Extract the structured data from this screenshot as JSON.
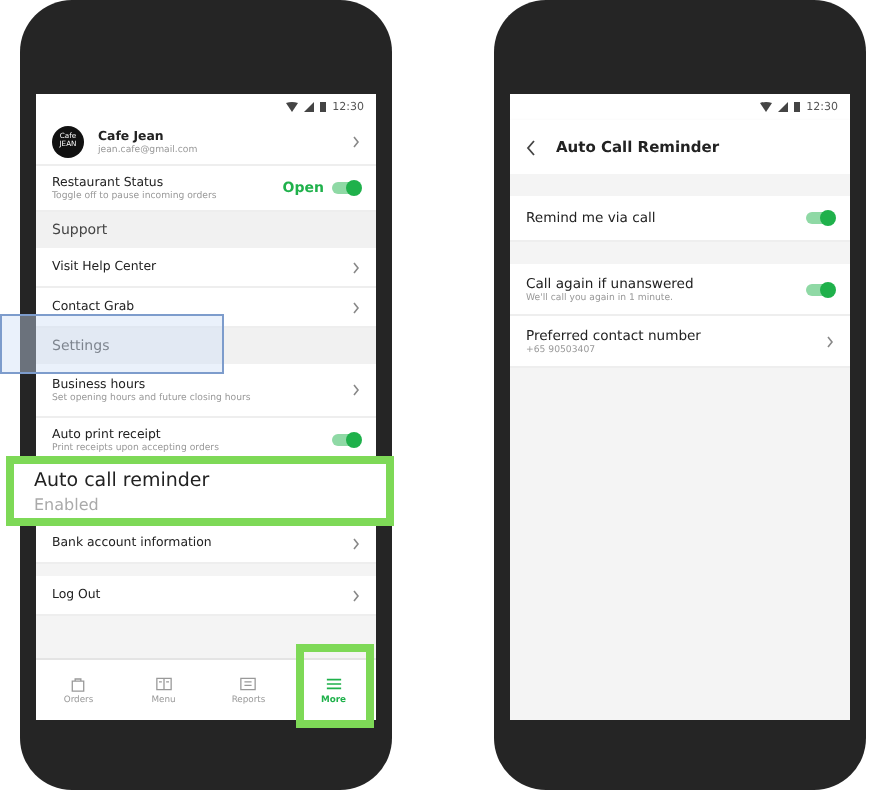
{
  "left_screen": {
    "status_bar": {
      "time": "12:30"
    },
    "profile": {
      "logo_lines": [
        "Cafe",
        "JEAN"
      ],
      "name": "Cafe Jean",
      "email": "jean.cafe@gmail.com"
    },
    "items": [
      {
        "kind": "toggle",
        "title": "Restaurant Status",
        "subtitle": "Toggle off to pause incoming orders",
        "status": "Open",
        "on": true
      },
      {
        "kind": "header",
        "title": "Support"
      },
      {
        "kind": "link",
        "title": "Visit Help Center"
      },
      {
        "kind": "link",
        "title": "Contact Grab"
      },
      {
        "kind": "header",
        "title": "Settings"
      },
      {
        "kind": "link",
        "title": "Business hours",
        "subtitle": "Set opening hours and future closing hours"
      },
      {
        "kind": "toggle",
        "title": "Auto print receipt",
        "subtitle": "Print receipts upon accepting orders",
        "on": true
      },
      {
        "kind": "covered"
      },
      {
        "kind": "link",
        "title": "Bank account information"
      },
      {
        "kind": "gap"
      },
      {
        "kind": "link",
        "title": "Log Out"
      }
    ],
    "tabs": [
      {
        "label": "Orders",
        "selected": false
      },
      {
        "label": "Menu",
        "selected": false
      },
      {
        "label": "Reports",
        "selected": false
      },
      {
        "label": "More",
        "selected": true
      }
    ],
    "callout": {
      "title": "Auto call reminder",
      "subtitle": "Enabled"
    }
  },
  "right_screen": {
    "status_bar": {
      "time": "12:30"
    },
    "title": "Auto Call Reminder",
    "items": [
      {
        "kind": "gap"
      },
      {
        "kind": "toggle",
        "title": "Remind me via call",
        "on": true
      },
      {
        "kind": "gap"
      },
      {
        "kind": "toggle",
        "title": "Call again if unanswered",
        "subtitle": "We'll call you again in 1 minute.",
        "on": true
      },
      {
        "kind": "link",
        "title": "Preferred contact number",
        "subtitle": "+65 90503407"
      }
    ]
  }
}
